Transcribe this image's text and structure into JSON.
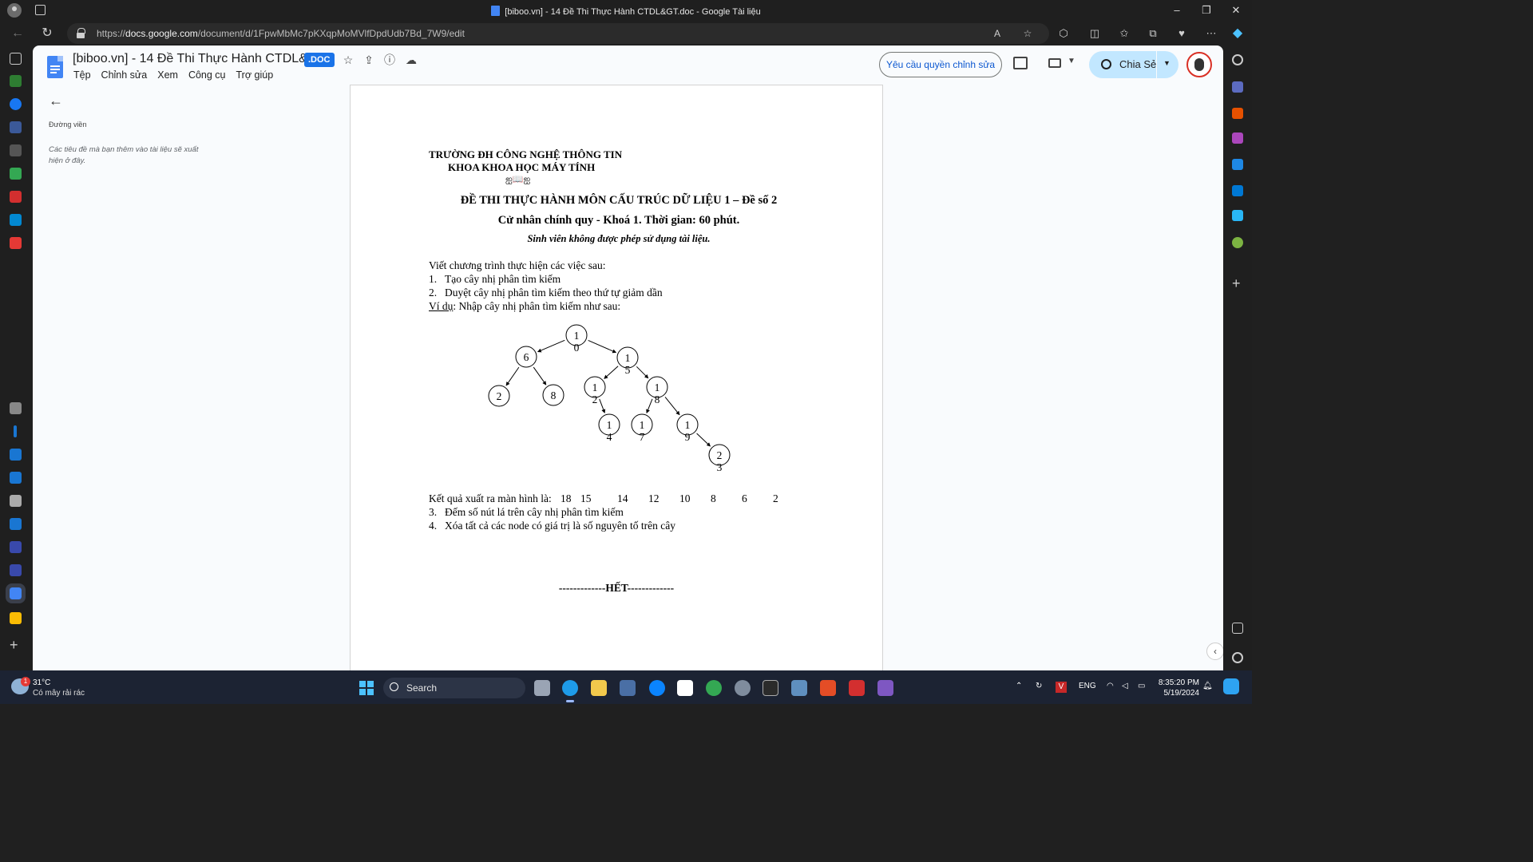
{
  "browser": {
    "window_title": "[biboo.vn] - 14 Đề Thi Thực Hành CTDL&GT.doc - Google Tài liệu",
    "url_prefix": "https://",
    "url_domain": "docs.google.com",
    "url_path": "/document/d/1FpwMbMc7pKXqpMoMVlfDpdUdb7Bd_7W9/edit"
  },
  "docs": {
    "title": "[biboo.vn] - 14 Đề Thi Thực Hành CTDL&GT",
    "badge": ".DOC",
    "menu": [
      "Tệp",
      "Chỉnh sửa",
      "Xem",
      "Công cụ",
      "Trợ giúp"
    ],
    "request_edit": "Yêu cầu quyền chỉnh sửa",
    "share": "Chia Sẻ",
    "colors": {
      "accent": "#1a73e8",
      "share_bg": "#c2e7ff",
      "link": "#0b57d0"
    }
  },
  "outline": {
    "heading": "Đường viền",
    "hint": "Các tiêu đề mà bạn thêm vào tài liệu sẽ xuất hiện ở đây."
  },
  "document": {
    "school": "TRƯỜNG ĐH CÔNG NGHỆ THÔNG TIN",
    "faculty": "KHOA KHOA HỌC MÁY TÍNH",
    "ornament": "ஐ📖ஐ",
    "exam_title": "ĐỀ THI THỰC HÀNH MÔN CẤU TRÚC DỮ LIỆU 1 – Đề số 2",
    "exam_sub": "Cử nhân chính quy - Khoá 1. Thời gian: 60 phút.",
    "note": "Sinh viên không được phép sử dụng tài liệu.",
    "intro": "Viết chương trình thực hiện các việc sau:",
    "item1_num": "1.",
    "item1": "Tạo cây nhị phân tìm kiếm",
    "item2_num": "2.",
    "item2": "Duyệt cây nhị phân tìm kiếm theo thứ tự giảm dần",
    "example_label": "Ví dụ",
    "example_text": ": Nhập cây nhị phân tìm kiếm như sau:",
    "result_label": "Kết quả xuất ra màn hình là:",
    "result_values": [
      "18",
      "15",
      "14",
      "12",
      "10",
      "8",
      "6",
      "2"
    ],
    "item3_num": "3.",
    "item3": "Đếm số nút lá trên cây nhị phân tìm kiếm",
    "item4_num": "4.",
    "item4": "Xóa tất cả các node có giá trị là số nguyên tố trên cây",
    "end": "-------------HẾT-------------",
    "tree_nodes": [
      {
        "key": "10",
        "line1": "1",
        "line2": "0"
      },
      {
        "key": "6",
        "line1": "6",
        "line2": ""
      },
      {
        "key": "15",
        "line1": "1",
        "line2": "5"
      },
      {
        "key": "2",
        "line1": "2",
        "line2": ""
      },
      {
        "key": "8",
        "line1": "8",
        "line2": ""
      },
      {
        "key": "12",
        "line1": "1",
        "line2": "2"
      },
      {
        "key": "18",
        "line1": "1",
        "line2": "8"
      },
      {
        "key": "14",
        "line1": "1",
        "line2": "4"
      },
      {
        "key": "17",
        "line1": "1",
        "line2": "7"
      },
      {
        "key": "19",
        "line1": "1",
        "line2": "9"
      },
      {
        "key": "23",
        "line1": "2",
        "line2": "3"
      }
    ]
  },
  "taskbar": {
    "weather_temp": "31°C",
    "weather_desc": "Có mây rải rác",
    "weather_badge": "1",
    "search": "Search",
    "lang": "ENG",
    "time": "8:35:20 PM",
    "date": "5/19/2024"
  }
}
